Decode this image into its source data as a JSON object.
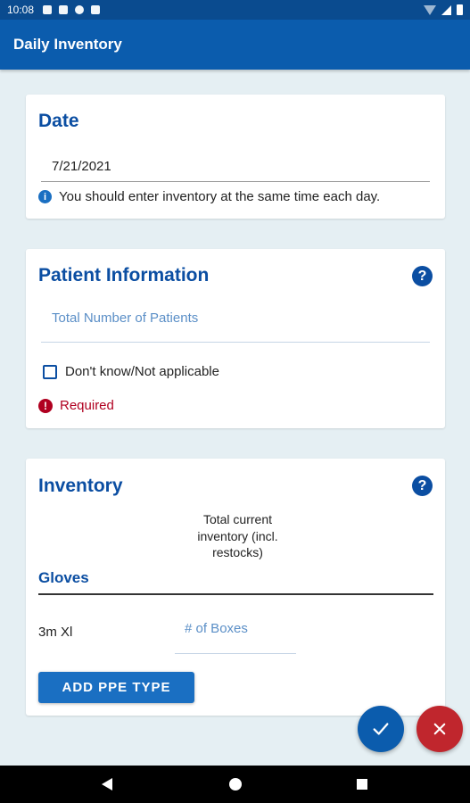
{
  "status_bar": {
    "time": "10:08"
  },
  "app_bar": {
    "title": "Daily Inventory"
  },
  "date_card": {
    "title": "Date",
    "value": "7/21/2021",
    "info_text": "You should enter inventory at the same time each day."
  },
  "patient_card": {
    "title": "Patient Information",
    "total_patients_placeholder": "Total Number of Patients",
    "checkbox_label": "Don't know/Not applicable",
    "checkbox_checked": false,
    "required_text": "Required"
  },
  "inventory_card": {
    "title": "Inventory",
    "column_header": "Total current inventory (incl. restocks)",
    "section": "Gloves",
    "items": [
      {
        "name": "3m Xl",
        "placeholder": "# of Boxes"
      }
    ],
    "add_button_label": "ADD PPE TYPE"
  },
  "icons": {
    "help": "help-icon",
    "info": "info-icon",
    "error": "error-icon",
    "confirm": "check-icon",
    "cancel": "close-icon"
  },
  "colors": {
    "app_bar": "#0b5cad",
    "status_bar": "#0a4b8f",
    "accent": "#0b4ea2",
    "button": "#1a6fc2",
    "error": "#b00020",
    "cancel_fab": "#c0262d",
    "background": "#e5eff3"
  }
}
